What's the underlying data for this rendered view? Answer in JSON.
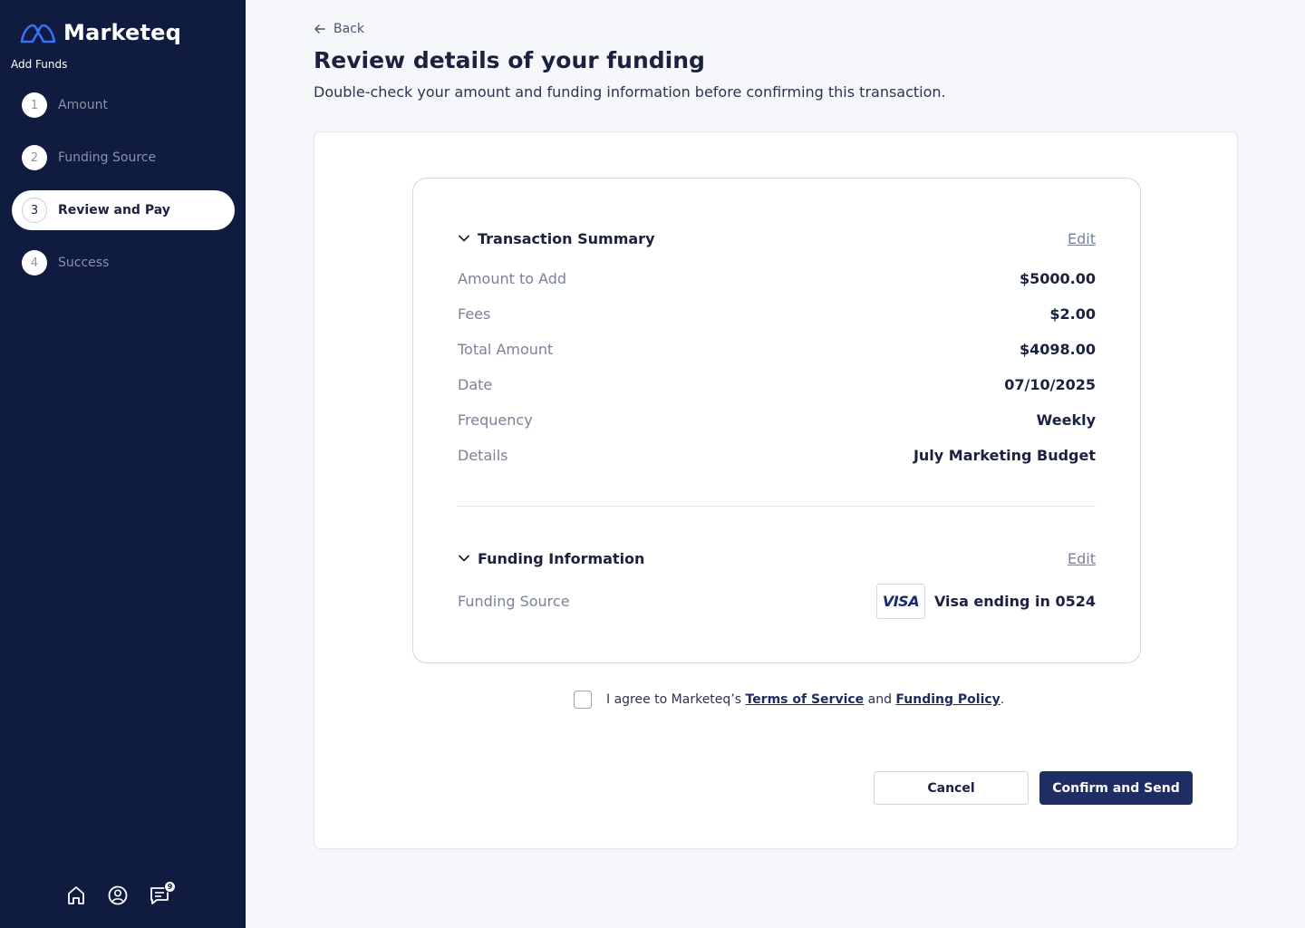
{
  "app": {
    "brand": "Marketeq",
    "section": "Add Funds"
  },
  "steps": [
    {
      "num": "1",
      "label": "Amount"
    },
    {
      "num": "2",
      "label": "Funding Source"
    },
    {
      "num": "3",
      "label": "Review and Pay"
    },
    {
      "num": "4",
      "label": "Success"
    }
  ],
  "active_step": 3,
  "nav_icons": [
    "home-icon",
    "profile-icon",
    "messages-icon"
  ],
  "messages_badge": "9",
  "back_label": "Back",
  "title": "Review details of your funding",
  "subtitle": "Double-check your amount and funding information before confirming this transaction.",
  "transaction": {
    "title": "Transaction Summary",
    "edit": "Edit",
    "rows": [
      {
        "label": "Amount to Add",
        "value": "$5000.00"
      },
      {
        "label": "Fees",
        "value": "$2.00"
      },
      {
        "label": "Total Amount",
        "value": "$4098.00"
      },
      {
        "label": "Date",
        "value": "07/10/2025"
      },
      {
        "label": "Frequency",
        "value": "Weekly"
      },
      {
        "label": "Details",
        "value": "July Marketing Budget"
      }
    ]
  },
  "funding": {
    "title": "Funding Information",
    "edit": "Edit",
    "source_label": "Funding Source",
    "card_brand": "VISA",
    "source_value": "Visa ending in 0524"
  },
  "agreement": {
    "prefix": "I agree to Marketeq’s ",
    "terms": "Terms of Service",
    "and": " and ",
    "policy": "Funding Policy",
    "suffix": "."
  },
  "actions": {
    "cancel": "Cancel",
    "confirm": "Confirm and Send"
  },
  "colors": {
    "sidebar": "#0f1b3f",
    "primary": "#1e2d63",
    "accent_logo": "#3b6ff5"
  }
}
